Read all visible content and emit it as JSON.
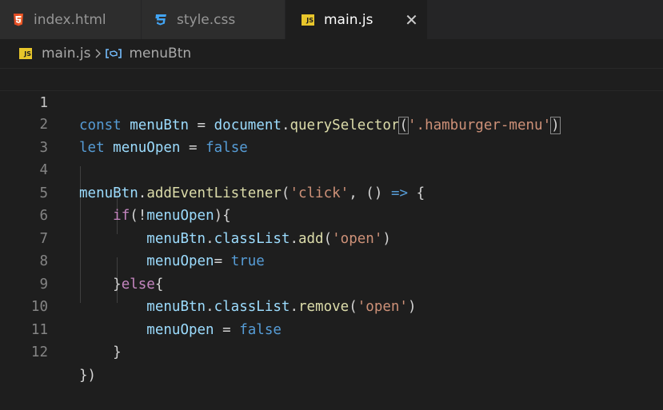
{
  "tabs": [
    {
      "label": "index.html",
      "icon": "html5-icon"
    },
    {
      "label": "style.css",
      "icon": "css3-icon"
    },
    {
      "label": "main.js",
      "icon": "js-icon",
      "active": true
    }
  ],
  "tab_close_glyph": "✕",
  "breadcrumb": {
    "file": "main.js",
    "symbol": "menuBtn"
  },
  "colors": {
    "keyword": "#569cd6",
    "variable": "#9cdcfe",
    "function": "#dcdcaa",
    "string": "#ce9178",
    "plain": "#d4d4d4",
    "js_badge": "#e8c62b",
    "html_icon": "#e44d26",
    "css_icon": "#42a5f5"
  },
  "code": {
    "line_numbers": [
      "1",
      "2",
      "3",
      "4",
      "5",
      "6",
      "7",
      "8",
      "9",
      "10",
      "11",
      "12"
    ],
    "lines": [
      "const menuBtn = document.querySelector('.hamburger-menu')",
      "let menuOpen = false",
      "",
      "menuBtn.addEventListener('click', () => {",
      "    if(!menuOpen){",
      "        menuBtn.classList.add('open')",
      "        menuOpen= true",
      "    }else{",
      "        menuBtn.classList.remove('open')",
      "        menuOpen = false",
      "    }",
      "})"
    ]
  }
}
